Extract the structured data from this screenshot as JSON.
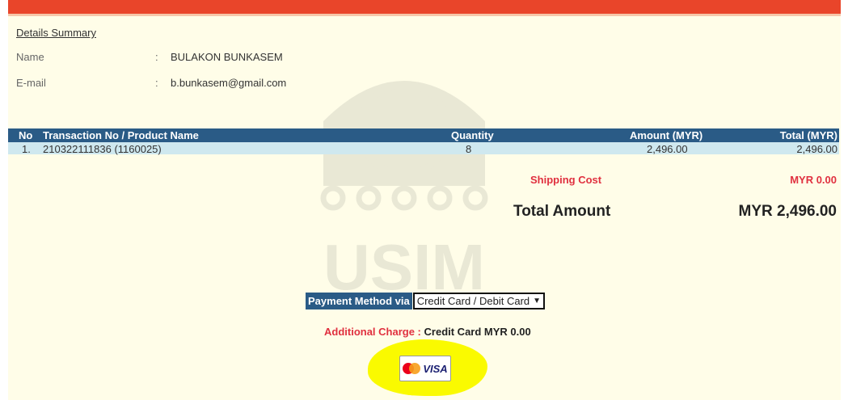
{
  "details": {
    "title": "Details Summary",
    "name_label": "Name",
    "name_value": "BULAKON BUNKASEM",
    "email_label": "E-mail",
    "email_value": "b.bunkasem@gmail.com",
    "colon": ":"
  },
  "table": {
    "headers": [
      "No",
      "Transaction No / Product Name",
      "Quantity",
      "Amount (MYR)",
      "Total (MYR)"
    ],
    "rows": [
      [
        "1.",
        "210322111836 (1160025)",
        "8",
        "2,496.00",
        "2,496.00"
      ]
    ]
  },
  "summary": {
    "shipping_label": "Shipping Cost",
    "shipping_value": "MYR 0.00",
    "total_label": "Total Amount",
    "total_value": "MYR 2,496.00"
  },
  "payment": {
    "label": "Payment Method via",
    "selected": "Credit Card / Debit Card"
  },
  "charge": {
    "label": "Additional Charge :",
    "value": "Credit Card MYR 0.00"
  },
  "logos": {
    "card_brand_text": "VISA",
    "watermark_text": "USIM"
  },
  "colors": {
    "header_bar": "#e9452a",
    "table_header": "#2a5b86",
    "row_bg": "#cfe8ef",
    "accent_red": "#e0303f",
    "highlight": "#fafa00"
  },
  "icons": {
    "select_arrow": "chevron-down-icon",
    "mastercard": "mastercard-icon",
    "visa": "visa-icon"
  }
}
